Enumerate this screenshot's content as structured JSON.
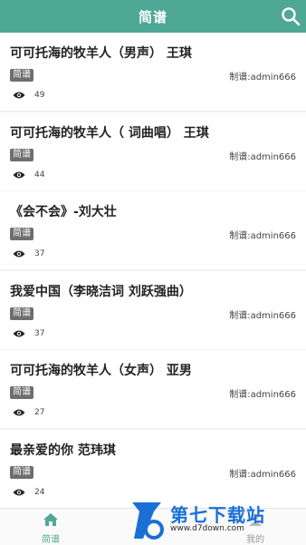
{
  "header": {
    "title": "简谱"
  },
  "items": [
    {
      "title": "可可托海的牧羊人（男声） 王琪",
      "tag": "简谱",
      "author": "制谱:admin666",
      "views": "49"
    },
    {
      "title": "可可托海的牧羊人（ 词曲唱） 王琪",
      "tag": "简谱",
      "author": "制谱:admin666",
      "views": "44"
    },
    {
      "title": "《会不会》-刘大壮",
      "tag": "简谱",
      "author": "制谱:admin666",
      "views": "37"
    },
    {
      "title": "我爱中国（李晓洁词 刘跃强曲）",
      "tag": "简谱",
      "author": "制谱:admin666",
      "views": "37"
    },
    {
      "title": "可可托海的牧羊人（女声） 亚男",
      "tag": "简谱",
      "author": "制谱:admin666",
      "views": "27"
    },
    {
      "title": "最亲爱的你 范玮琪",
      "tag": "简谱",
      "author": "制谱:admin666",
      "views": "24"
    }
  ],
  "tabbar": {
    "home_label": "简谱",
    "mine_label": "我的"
  },
  "watermark": {
    "text": "第七下载站",
    "url": "www.d7down.com"
  },
  "colors": {
    "accent": "#4fa896",
    "tag_bg": "#6e6e6e",
    "watermark": "#1a6fd6"
  }
}
